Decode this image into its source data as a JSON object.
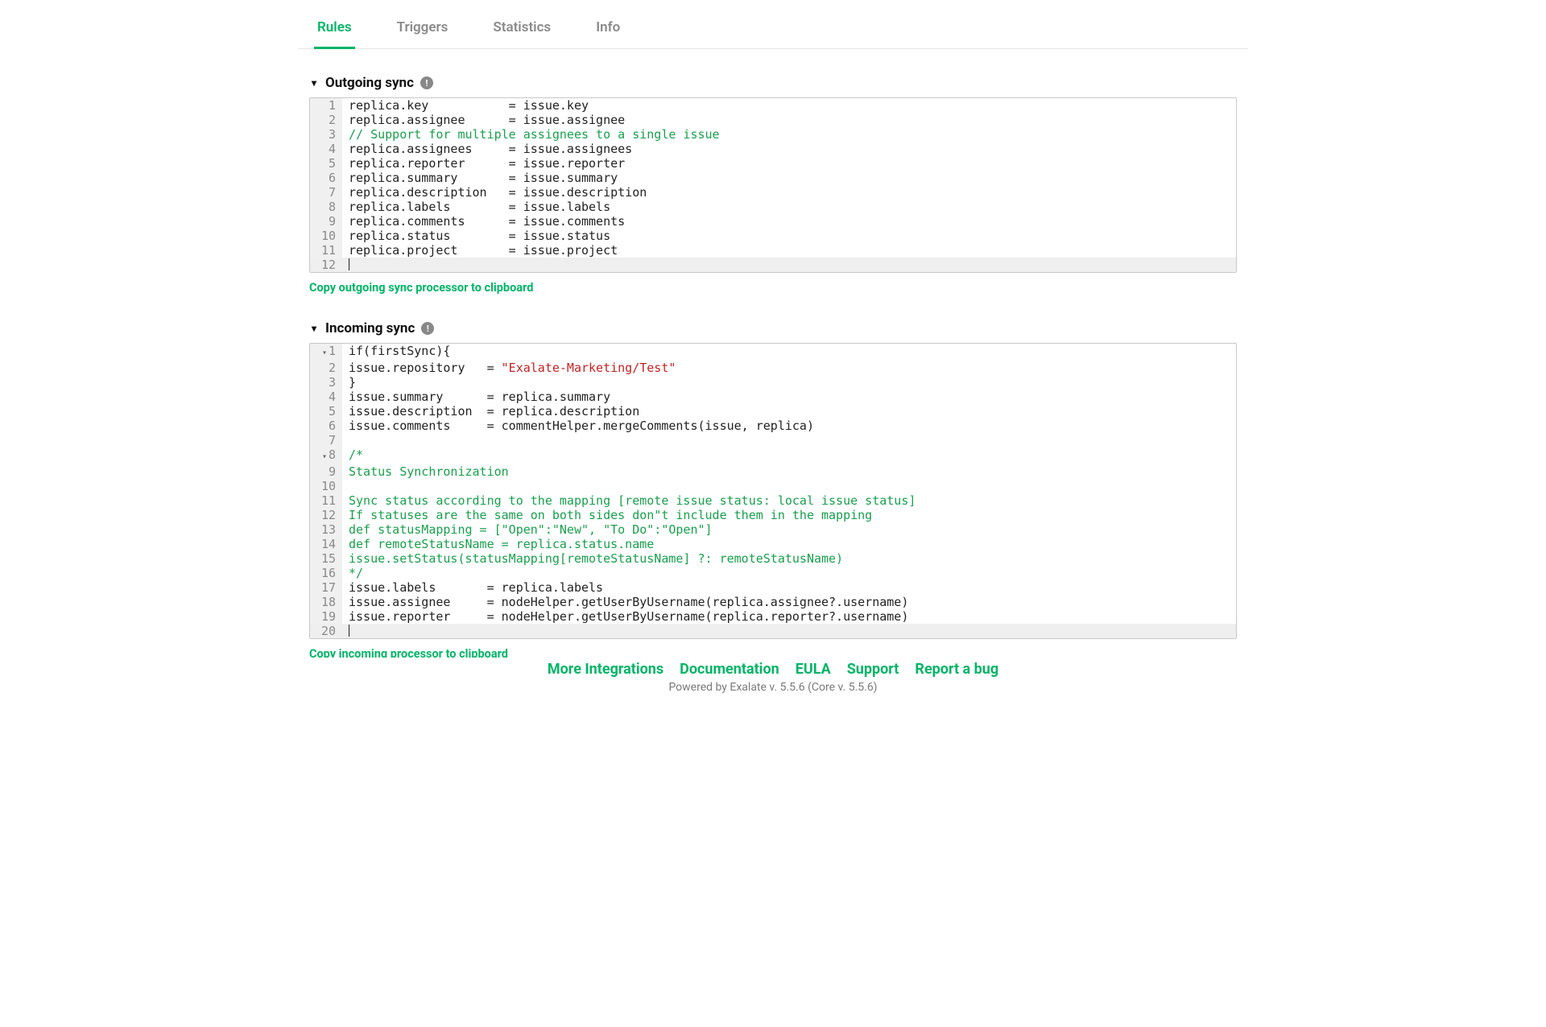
{
  "tabs": {
    "rules": "Rules",
    "triggers": "Triggers",
    "statistics": "Statistics",
    "info": "Info"
  },
  "outgoing": {
    "title": "Outgoing sync",
    "copy_label": "Copy outgoing sync processor to clipboard",
    "lines": [
      {
        "n": "1",
        "segments": [
          {
            "t": "plain",
            "v": "replica.key           = issue.key"
          }
        ]
      },
      {
        "n": "2",
        "segments": [
          {
            "t": "plain",
            "v": "replica.assignee      = issue.assignee"
          }
        ]
      },
      {
        "n": "3",
        "segments": [
          {
            "t": "comment",
            "v": "// Support for multiple assignees to a single issue"
          }
        ]
      },
      {
        "n": "4",
        "segments": [
          {
            "t": "plain",
            "v": "replica.assignees     = issue.assignees"
          }
        ]
      },
      {
        "n": "5",
        "segments": [
          {
            "t": "plain",
            "v": "replica.reporter      = issue.reporter"
          }
        ]
      },
      {
        "n": "6",
        "segments": [
          {
            "t": "plain",
            "v": "replica.summary       = issue.summary"
          }
        ]
      },
      {
        "n": "7",
        "segments": [
          {
            "t": "plain",
            "v": "replica.description   = issue.description"
          }
        ]
      },
      {
        "n": "8",
        "segments": [
          {
            "t": "plain",
            "v": "replica.labels        = issue.labels"
          }
        ]
      },
      {
        "n": "9",
        "segments": [
          {
            "t": "plain",
            "v": "replica.comments      = issue.comments"
          }
        ]
      },
      {
        "n": "10",
        "segments": [
          {
            "t": "plain",
            "v": "replica.status        = issue.status"
          }
        ]
      },
      {
        "n": "11",
        "segments": [
          {
            "t": "plain",
            "v": "replica.project       = issue.project"
          }
        ]
      },
      {
        "n": "12",
        "segments": [],
        "empty_last": true
      }
    ]
  },
  "incoming": {
    "title": "Incoming sync",
    "copy_label": "Copy incoming processor to clipboard",
    "lines": [
      {
        "n": "1",
        "fold": true,
        "segments": [
          {
            "t": "plain",
            "v": "if(firstSync){"
          }
        ]
      },
      {
        "n": "2",
        "segments": [
          {
            "t": "plain",
            "v": "issue.repository   = "
          },
          {
            "t": "string",
            "v": "\"Exalate-Marketing/Test\""
          }
        ]
      },
      {
        "n": "3",
        "segments": [
          {
            "t": "plain",
            "v": "}"
          }
        ]
      },
      {
        "n": "4",
        "segments": [
          {
            "t": "plain",
            "v": "issue.summary      = replica.summary"
          }
        ]
      },
      {
        "n": "5",
        "segments": [
          {
            "t": "plain",
            "v": "issue.description  = replica.description"
          }
        ]
      },
      {
        "n": "6",
        "segments": [
          {
            "t": "plain",
            "v": "issue.comments     = commentHelper.mergeComments(issue, replica)"
          }
        ]
      },
      {
        "n": "7",
        "segments": []
      },
      {
        "n": "8",
        "fold": true,
        "segments": [
          {
            "t": "comment",
            "v": "/*"
          }
        ]
      },
      {
        "n": "9",
        "segments": [
          {
            "t": "comment",
            "v": "Status Synchronization"
          }
        ]
      },
      {
        "n": "10",
        "segments": []
      },
      {
        "n": "11",
        "segments": [
          {
            "t": "comment",
            "v": "Sync status according to the mapping [remote issue status: local issue status]"
          }
        ]
      },
      {
        "n": "12",
        "segments": [
          {
            "t": "comment",
            "v": "If statuses are the same on both sides don\"t include them in the mapping"
          }
        ]
      },
      {
        "n": "13",
        "segments": [
          {
            "t": "comment",
            "v": "def statusMapping = [\"Open\":\"New\", \"To Do\":\"Open\"]"
          }
        ]
      },
      {
        "n": "14",
        "segments": [
          {
            "t": "comment",
            "v": "def remoteStatusName = replica.status.name"
          }
        ]
      },
      {
        "n": "15",
        "segments": [
          {
            "t": "comment",
            "v": "issue.setStatus(statusMapping[remoteStatusName] ?: remoteStatusName)"
          }
        ]
      },
      {
        "n": "16",
        "segments": [
          {
            "t": "comment",
            "v": "*/"
          }
        ]
      },
      {
        "n": "17",
        "segments": [
          {
            "t": "plain",
            "v": "issue.labels       = replica.labels"
          }
        ]
      },
      {
        "n": "18",
        "segments": [
          {
            "t": "plain",
            "v": "issue.assignee     = nodeHelper.getUserByUsername(replica.assignee?.username)"
          }
        ]
      },
      {
        "n": "19",
        "segments": [
          {
            "t": "plain",
            "v": "issue.reporter     = nodeHelper.getUserByUsername(replica.reporter?.username)"
          }
        ]
      },
      {
        "n": "20",
        "segments": [],
        "empty_last": true
      }
    ]
  },
  "footer": {
    "links": {
      "more": "More Integrations",
      "docs": "Documentation",
      "eula": "EULA",
      "support": "Support",
      "bug": "Report a bug"
    },
    "powered": "Powered by Exalate v. 5.5.6 (Core v. 5.5.6)"
  }
}
